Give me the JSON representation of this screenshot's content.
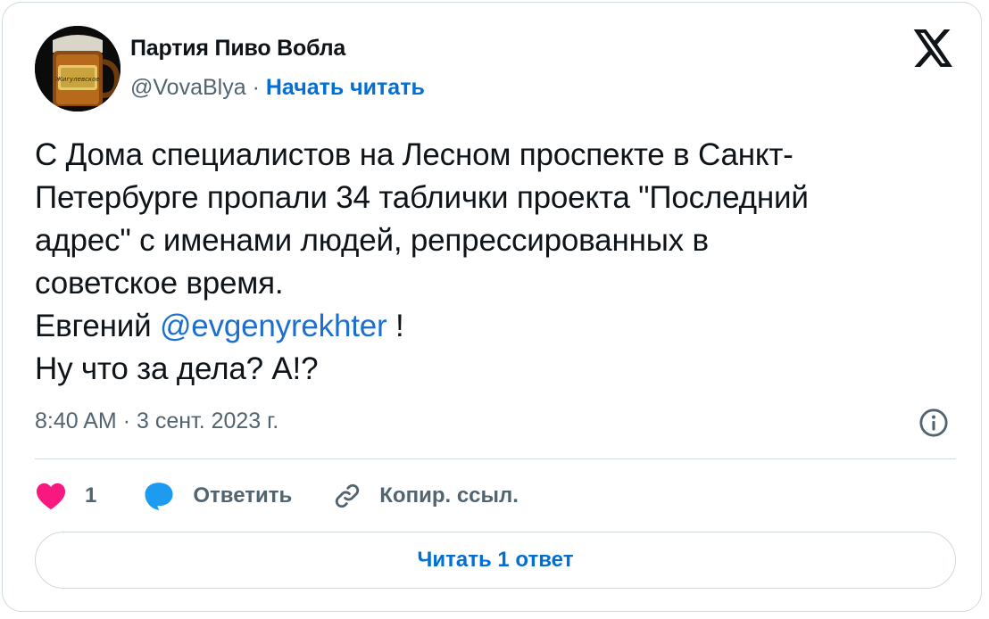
{
  "author": {
    "display_name": "Партия Пиво Вобла",
    "handle": "@VovaBlya",
    "separator": "·",
    "follow_label": "Начать читать",
    "avatar_label_text": "Жигулевское"
  },
  "brand": {
    "logo_icon": "x-logo-icon"
  },
  "tweet": {
    "lines": [
      "С Дома специалистов на Лесном проспекте в Санкт-",
      "Петербурге пропали 34 таблички проекта \"Последний",
      "адрес\" с именами людей, репрессированных в",
      "советское время."
    ],
    "mention_prefix": "Евгений",
    "mention": "@evgenyrekhter",
    "mention_suffix": " !",
    "last_line": "Ну что за дела? А!?"
  },
  "meta": {
    "time": "8:40 AM",
    "separator": "·",
    "date": "3 сент. 2023 г.",
    "info_icon": "info-icon"
  },
  "actions": {
    "like_count": "1",
    "reply_label": "Ответить",
    "copy_label": "Копир. ссыл."
  },
  "read_replies_label": "Читать 1 ответ",
  "colors": {
    "accent": "#006fd6",
    "like": "#f91880",
    "reply": "#1d9bf0",
    "muted": "#536471",
    "border": "#cfd9de"
  }
}
